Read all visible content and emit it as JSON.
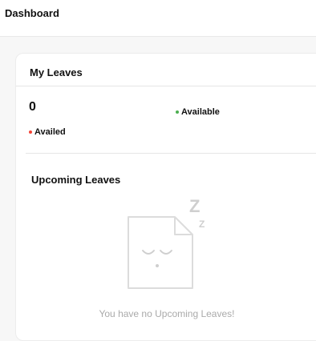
{
  "header": {
    "title": "Dashboard"
  },
  "leaves_card": {
    "title": "My Leaves",
    "count": "0",
    "legend": [
      {
        "label": "Available",
        "color": "#4caf50"
      },
      {
        "label": "Availed",
        "color": "#f44336"
      }
    ]
  },
  "upcoming": {
    "title": "Upcoming Leaves",
    "empty_message": "You have no Upcoming Leaves!",
    "icon": "sleeping-document-icon"
  }
}
